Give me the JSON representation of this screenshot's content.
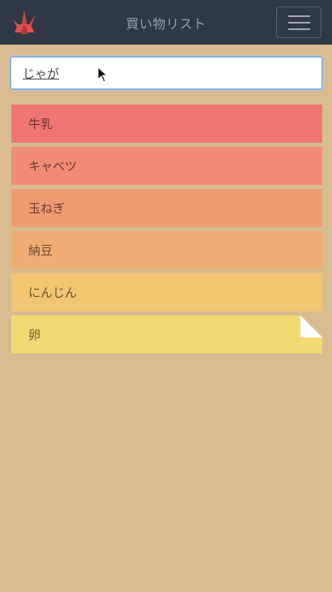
{
  "app": {
    "title": "買い物リスト",
    "logo_icon": "paper-crane-icon",
    "menu_icon": "hamburger-menu-icon",
    "colors": {
      "navbar": "#323843",
      "background": "#d8bb8f",
      "logo": "#e0524f"
    }
  },
  "search": {
    "value": "じゃが"
  },
  "items": [
    {
      "label": "牛乳",
      "color": "#ee7572"
    },
    {
      "label": "キャベツ",
      "color": "#f08c76"
    },
    {
      "label": "玉ねぎ",
      "color": "#f19b72"
    },
    {
      "label": "納豆",
      "color": "#f0ad72"
    },
    {
      "label": "にんじん",
      "color": "#f2c573"
    },
    {
      "label": "卵",
      "color": "#f1da72",
      "corner": "page-curl-icon"
    }
  ]
}
